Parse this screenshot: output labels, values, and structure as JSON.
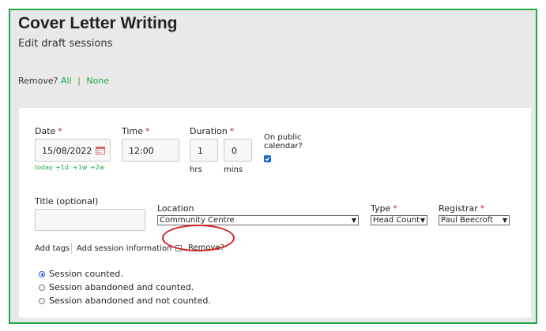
{
  "header": {
    "title": "Cover Letter Writing",
    "subtitle": "Edit draft sessions",
    "remove_label": "Remove?",
    "remove_all": "All",
    "remove_separator": "|",
    "remove_none": "None"
  },
  "form": {
    "date": {
      "label": "Date",
      "required": "*",
      "value": "15/08/2022",
      "shortcuts": [
        "today",
        "+1d",
        "+1w",
        "+2w"
      ]
    },
    "time": {
      "label": "Time",
      "required": "*",
      "value": "12:00"
    },
    "duration": {
      "label": "Duration",
      "required": "*",
      "hrs_value": "1",
      "mins_value": "0",
      "hrs_label": "hrs",
      "mins_label": "mins"
    },
    "public_calendar": {
      "label_line1": "On public",
      "label_line2": "calendar?",
      "checked": true
    },
    "title_field": {
      "label": "Title (optional)",
      "value": ""
    },
    "location": {
      "label": "Location",
      "value": "Community Centre"
    },
    "type": {
      "label": "Type",
      "required": "*",
      "value": "Head Count"
    },
    "registrar": {
      "label": "Registrar",
      "required": "*",
      "value": "Paul Beecroft"
    },
    "links": {
      "add_tags": "Add tags",
      "add_session_info": "Add session information"
    },
    "remove_checkbox": {
      "label": "Remove?",
      "checked": false
    },
    "status_options": [
      {
        "label": "Session counted.",
        "selected": true
      },
      {
        "label": "Session abandoned and counted.",
        "selected": false
      },
      {
        "label": "Session abandoned and not counted.",
        "selected": false
      }
    ]
  },
  "colors": {
    "accent": "#22a84a",
    "required": "#d42020",
    "highlight": "#d42020",
    "radio": "#1a66d6"
  },
  "icons": {
    "date_picker": "calendar-icon",
    "public_check": "checkbox-checked-icon"
  }
}
